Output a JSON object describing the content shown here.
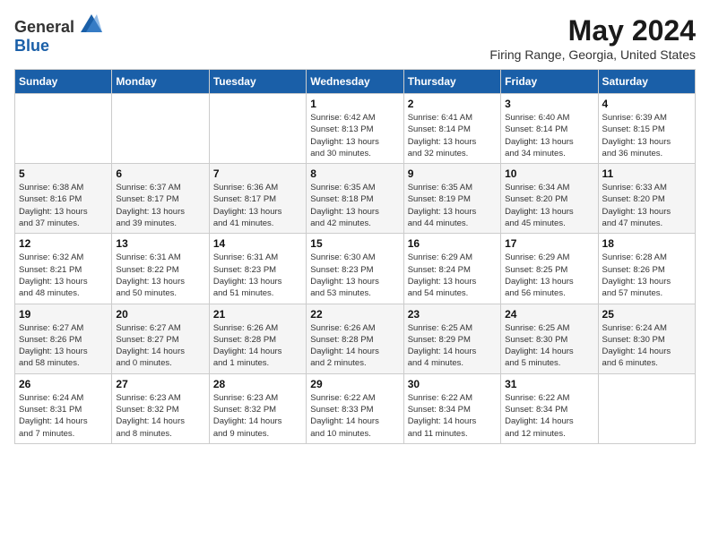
{
  "logo": {
    "general": "General",
    "blue": "Blue"
  },
  "title": "May 2024",
  "location": "Firing Range, Georgia, United States",
  "days_of_week": [
    "Sunday",
    "Monday",
    "Tuesday",
    "Wednesday",
    "Thursday",
    "Friday",
    "Saturday"
  ],
  "weeks": [
    [
      {
        "day": "",
        "info": ""
      },
      {
        "day": "",
        "info": ""
      },
      {
        "day": "",
        "info": ""
      },
      {
        "day": "1",
        "info": "Sunrise: 6:42 AM\nSunset: 8:13 PM\nDaylight: 13 hours\nand 30 minutes."
      },
      {
        "day": "2",
        "info": "Sunrise: 6:41 AM\nSunset: 8:14 PM\nDaylight: 13 hours\nand 32 minutes."
      },
      {
        "day": "3",
        "info": "Sunrise: 6:40 AM\nSunset: 8:14 PM\nDaylight: 13 hours\nand 34 minutes."
      },
      {
        "day": "4",
        "info": "Sunrise: 6:39 AM\nSunset: 8:15 PM\nDaylight: 13 hours\nand 36 minutes."
      }
    ],
    [
      {
        "day": "5",
        "info": "Sunrise: 6:38 AM\nSunset: 8:16 PM\nDaylight: 13 hours\nand 37 minutes."
      },
      {
        "day": "6",
        "info": "Sunrise: 6:37 AM\nSunset: 8:17 PM\nDaylight: 13 hours\nand 39 minutes."
      },
      {
        "day": "7",
        "info": "Sunrise: 6:36 AM\nSunset: 8:17 PM\nDaylight: 13 hours\nand 41 minutes."
      },
      {
        "day": "8",
        "info": "Sunrise: 6:35 AM\nSunset: 8:18 PM\nDaylight: 13 hours\nand 42 minutes."
      },
      {
        "day": "9",
        "info": "Sunrise: 6:35 AM\nSunset: 8:19 PM\nDaylight: 13 hours\nand 44 minutes."
      },
      {
        "day": "10",
        "info": "Sunrise: 6:34 AM\nSunset: 8:20 PM\nDaylight: 13 hours\nand 45 minutes."
      },
      {
        "day": "11",
        "info": "Sunrise: 6:33 AM\nSunset: 8:20 PM\nDaylight: 13 hours\nand 47 minutes."
      }
    ],
    [
      {
        "day": "12",
        "info": "Sunrise: 6:32 AM\nSunset: 8:21 PM\nDaylight: 13 hours\nand 48 minutes."
      },
      {
        "day": "13",
        "info": "Sunrise: 6:31 AM\nSunset: 8:22 PM\nDaylight: 13 hours\nand 50 minutes."
      },
      {
        "day": "14",
        "info": "Sunrise: 6:31 AM\nSunset: 8:23 PM\nDaylight: 13 hours\nand 51 minutes."
      },
      {
        "day": "15",
        "info": "Sunrise: 6:30 AM\nSunset: 8:23 PM\nDaylight: 13 hours\nand 53 minutes."
      },
      {
        "day": "16",
        "info": "Sunrise: 6:29 AM\nSunset: 8:24 PM\nDaylight: 13 hours\nand 54 minutes."
      },
      {
        "day": "17",
        "info": "Sunrise: 6:29 AM\nSunset: 8:25 PM\nDaylight: 13 hours\nand 56 minutes."
      },
      {
        "day": "18",
        "info": "Sunrise: 6:28 AM\nSunset: 8:26 PM\nDaylight: 13 hours\nand 57 minutes."
      }
    ],
    [
      {
        "day": "19",
        "info": "Sunrise: 6:27 AM\nSunset: 8:26 PM\nDaylight: 13 hours\nand 58 minutes."
      },
      {
        "day": "20",
        "info": "Sunrise: 6:27 AM\nSunset: 8:27 PM\nDaylight: 14 hours\nand 0 minutes."
      },
      {
        "day": "21",
        "info": "Sunrise: 6:26 AM\nSunset: 8:28 PM\nDaylight: 14 hours\nand 1 minutes."
      },
      {
        "day": "22",
        "info": "Sunrise: 6:26 AM\nSunset: 8:28 PM\nDaylight: 14 hours\nand 2 minutes."
      },
      {
        "day": "23",
        "info": "Sunrise: 6:25 AM\nSunset: 8:29 PM\nDaylight: 14 hours\nand 4 minutes."
      },
      {
        "day": "24",
        "info": "Sunrise: 6:25 AM\nSunset: 8:30 PM\nDaylight: 14 hours\nand 5 minutes."
      },
      {
        "day": "25",
        "info": "Sunrise: 6:24 AM\nSunset: 8:30 PM\nDaylight: 14 hours\nand 6 minutes."
      }
    ],
    [
      {
        "day": "26",
        "info": "Sunrise: 6:24 AM\nSunset: 8:31 PM\nDaylight: 14 hours\nand 7 minutes."
      },
      {
        "day": "27",
        "info": "Sunrise: 6:23 AM\nSunset: 8:32 PM\nDaylight: 14 hours\nand 8 minutes."
      },
      {
        "day": "28",
        "info": "Sunrise: 6:23 AM\nSunset: 8:32 PM\nDaylight: 14 hours\nand 9 minutes."
      },
      {
        "day": "29",
        "info": "Sunrise: 6:22 AM\nSunset: 8:33 PM\nDaylight: 14 hours\nand 10 minutes."
      },
      {
        "day": "30",
        "info": "Sunrise: 6:22 AM\nSunset: 8:34 PM\nDaylight: 14 hours\nand 11 minutes."
      },
      {
        "day": "31",
        "info": "Sunrise: 6:22 AM\nSunset: 8:34 PM\nDaylight: 14 hours\nand 12 minutes."
      },
      {
        "day": "",
        "info": ""
      }
    ]
  ]
}
